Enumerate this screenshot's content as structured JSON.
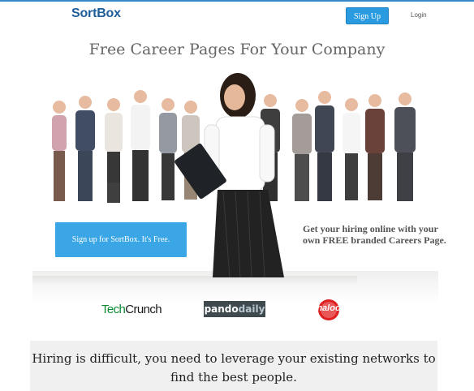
{
  "header": {
    "logo": "SortBox",
    "signup_label": "Sign Up",
    "login_label": "Login"
  },
  "hero": {
    "headline": "Free Career Pages For Your Company",
    "cta_label": "Sign up for SortBox. It's Free.",
    "tagline": "Get your hiring online with your own FREE branded Careers Page."
  },
  "press": {
    "techcrunch_tech": "Tech",
    "techcrunch_crunch": "Crunch",
    "pando_pando": "pando",
    "pando_daily": "daily",
    "haloo": "haloo"
  },
  "footer": {
    "message": "Hiring is difficult, you need to leverage your existing networks to find the best people."
  },
  "colors": {
    "accent": "#2b9be0",
    "logo": "#1d5d9a",
    "cta": "#3aa6e6"
  }
}
